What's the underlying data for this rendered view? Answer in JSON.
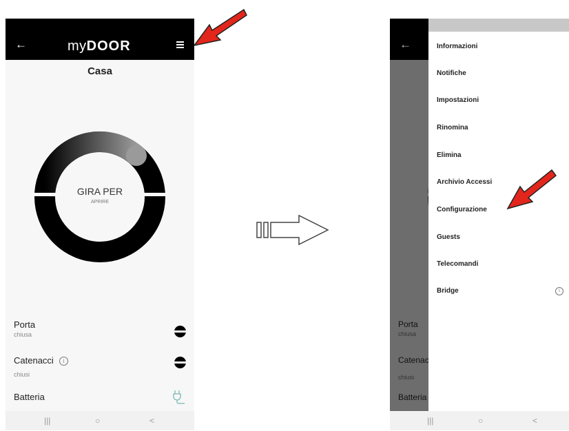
{
  "left_screen": {
    "back_icon": "arrow-left-icon",
    "logo": {
      "prefix": "my",
      "brand": "DOOR"
    },
    "menu_icon": "hamburger-menu-icon",
    "title": "Casa",
    "ring": {
      "main_label": "GIRA PER",
      "sub_label": "APRIRE"
    },
    "status": [
      {
        "label": "Porta",
        "value": "chiusa"
      },
      {
        "label": "Catenacci",
        "value": "chiusi"
      },
      {
        "label": "Batteria"
      }
    ],
    "nav": {
      "recents": "|||",
      "home": "○",
      "back": "<"
    }
  },
  "right_screen": {
    "menu_items": [
      "Informazioni",
      "Notifiche",
      "Impostazioni",
      "Rinomina",
      "Elimina",
      "Archivio Accessi",
      "Configurazione",
      "Guests",
      "Telecomandi",
      "Bridge"
    ],
    "background_labels": {
      "porta": "Porta",
      "porta_value": "chiusa",
      "catenacci": "Catenac",
      "catenacci_value": "chiusi",
      "batteria": "Batteria"
    },
    "nav": {
      "recents": "|||",
      "home": "○",
      "back": "<"
    }
  },
  "colors": {
    "annotation_arrow": "#e3261b",
    "appbar": "#000000",
    "plug": "#7ab8b0"
  }
}
